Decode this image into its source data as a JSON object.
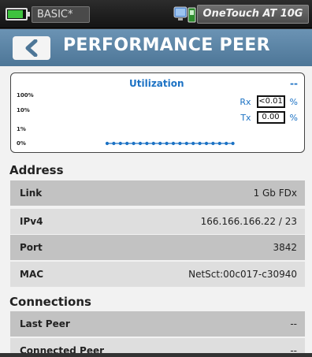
{
  "status_bar": {
    "profile": "BASIC*",
    "device_name": "OneTouch AT 10G",
    "battery_level": 0.85,
    "battery_color": "#3ec23e"
  },
  "header": {
    "title": "PERFORMANCE PEER",
    "back_icon": "chevron-left-icon"
  },
  "utilization": {
    "title": "Utilization",
    "status": "--",
    "y_labels": [
      "100%",
      "10%",
      "1%",
      "0%"
    ],
    "rx_label": "Rx",
    "rx_value": "<0.01",
    "tx_label": "Tx",
    "tx_value": "0.00",
    "unit": "%"
  },
  "address": {
    "heading": "Address",
    "rows": [
      {
        "label": "Link",
        "value": "1 Gb FDx"
      },
      {
        "label": "IPv4",
        "value": "166.166.166.22 / 23"
      },
      {
        "label": "Port",
        "value": "3842"
      },
      {
        "label": "MAC",
        "value": "NetSct:00c017-c30940"
      }
    ]
  },
  "connections": {
    "heading": "Connections",
    "rows": [
      {
        "label": "Last Peer",
        "value": "--"
      },
      {
        "label": "Connected Peer",
        "value": "--"
      }
    ]
  },
  "colors": {
    "accent": "#5d86a8",
    "chart_blue": "#1c72c4"
  }
}
